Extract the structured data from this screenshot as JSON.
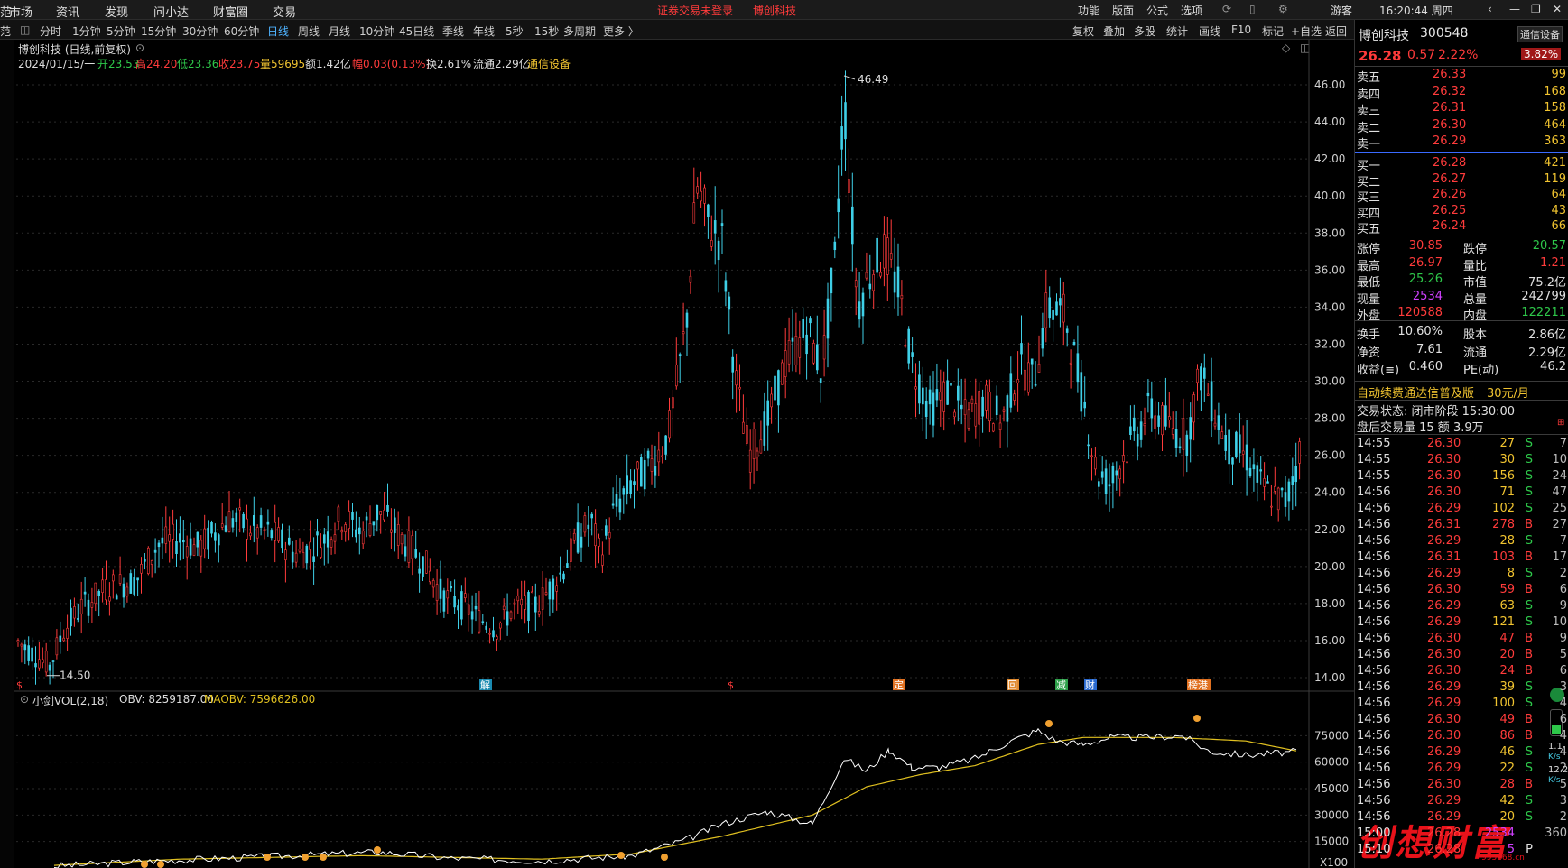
{
  "menu": {
    "left": [
      "范",
      "市场",
      "资讯",
      "发现",
      "问小达",
      "财富圈",
      "交易"
    ],
    "notice": "证券交易未登录",
    "stock_link": "博创科技",
    "right": [
      "功能",
      "版面",
      "公式",
      "选项"
    ],
    "guest": "游客",
    "clock": "16:20:44 周四"
  },
  "periods": [
    "分时",
    "1分钟",
    "5分钟",
    "15分钟",
    "30分钟",
    "60分钟",
    "日线",
    "周线",
    "月线",
    "10分钟",
    "45日线",
    "季线",
    "年线",
    "5秒",
    "15秒",
    "多周期",
    "更多 〉"
  ],
  "active_period": "日线",
  "tools": [
    "复权",
    "叠加",
    "多股",
    "统计",
    "画线",
    "F10",
    "标记",
    "+自选",
    "返回"
  ],
  "chart_header": {
    "title": "博创科技 (日线,前复权)",
    "date": "2024/01/15/一",
    "open": "开23.53",
    "high": "高24.20",
    "low": "低23.36",
    "close": "收23.75",
    "vol": "量59695",
    "amount": "额1.42亿",
    "range": "幅0.03(0.13%)",
    "turnover": "换2.61%",
    "float": "流通2.29亿",
    "sector": "通信设备"
  },
  "price_axis": [
    "46.00",
    "44.00",
    "42.00",
    "40.00",
    "38.00",
    "36.00",
    "34.00",
    "32.00",
    "30.00",
    "28.00",
    "26.00",
    "24.00",
    "22.00",
    "20.00",
    "18.00",
    "16.00",
    "14.00"
  ],
  "max_label": "46.49",
  "min_label": "14.50",
  "event_markers": [
    "$",
    "解",
    "$",
    "定",
    "回",
    "减",
    "财",
    "榜港"
  ],
  "indicator": {
    "name": "小剑VOL(2,18)",
    "obv": "OBV: 8259187.00",
    "maobv": "MAOBV: 7596626.00",
    "axis": [
      "75000",
      "60000",
      "45000",
      "30000",
      "15000"
    ],
    "unit": "X100"
  },
  "stock": {
    "name": "博创科技",
    "code": "300548",
    "sector_btn": "通信设备",
    "price": "26.28",
    "change": "0.57",
    "pct": "2.22%",
    "amp_badge": "3.82%"
  },
  "asks": [
    {
      "label": "卖五",
      "price": "26.33",
      "vol": "99"
    },
    {
      "label": "卖四",
      "price": "26.32",
      "vol": "168"
    },
    {
      "label": "卖三",
      "price": "26.31",
      "vol": "158"
    },
    {
      "label": "卖二",
      "price": "26.30",
      "vol": "464"
    },
    {
      "label": "卖一",
      "price": "26.29",
      "vol": "363"
    }
  ],
  "bids": [
    {
      "label": "买一",
      "price": "26.28",
      "vol": "421"
    },
    {
      "label": "买二",
      "price": "26.27",
      "vol": "119"
    },
    {
      "label": "买三",
      "price": "26.26",
      "vol": "64"
    },
    {
      "label": "买四",
      "price": "26.25",
      "vol": "43"
    },
    {
      "label": "买五",
      "price": "26.24",
      "vol": "66"
    }
  ],
  "stats": [
    {
      "k1": "涨停",
      "v1": "30.85",
      "c1": "red",
      "k2": "跌停",
      "v2": "20.57",
      "c2": "green"
    },
    {
      "k1": "最高",
      "v1": "26.97",
      "c1": "red",
      "k2": "量比",
      "v2": "1.21",
      "c2": "red"
    },
    {
      "k1": "最低",
      "v1": "25.26",
      "c1": "green",
      "k2": "市值",
      "v2": "75.2亿",
      "c2": "white"
    },
    {
      "k1": "现量",
      "v1": "2534",
      "c1": "purple",
      "k2": "总量",
      "v2": "242799",
      "c2": "white"
    },
    {
      "k1": "外盘",
      "v1": "120588",
      "c1": "red",
      "k2": "内盘",
      "v2": "122211",
      "c2": "green"
    }
  ],
  "stats2": [
    {
      "k1": "换手",
      "v1": "10.60%",
      "k2": "股本",
      "v2": "2.86亿"
    },
    {
      "k1": "净资",
      "v1": "7.61",
      "k2": "流通",
      "v2": "2.29亿"
    },
    {
      "k1": "收益(≡)",
      "v1": "0.460",
      "k2": "PE(动)",
      "v2": "46.2"
    }
  ],
  "promo": {
    "text": "自动续费通达信普及版",
    "price": "30元/月"
  },
  "trade_state": "交易状态: 闭市阶段 15:30:00",
  "after_hours": "盘后交易量 15 额 3.9万",
  "ticks": [
    {
      "t": "14:55",
      "p": "26.30",
      "v": "27",
      "s": "S",
      "n": "7"
    },
    {
      "t": "14:55",
      "p": "26.30",
      "v": "30",
      "s": "S",
      "n": "10"
    },
    {
      "t": "14:55",
      "p": "26.30",
      "v": "156",
      "s": "S",
      "n": "24"
    },
    {
      "t": "14:56",
      "p": "26.30",
      "v": "71",
      "s": "S",
      "n": "47"
    },
    {
      "t": "14:56",
      "p": "26.29",
      "v": "102",
      "s": "S",
      "n": "25"
    },
    {
      "t": "14:56",
      "p": "26.31",
      "v": "278",
      "s": "B",
      "n": "27"
    },
    {
      "t": "14:56",
      "p": "26.29",
      "v": "28",
      "s": "S",
      "n": "7"
    },
    {
      "t": "14:56",
      "p": "26.31",
      "v": "103",
      "s": "B",
      "n": "17"
    },
    {
      "t": "14:56",
      "p": "26.29",
      "v": "8",
      "s": "S",
      "n": "2"
    },
    {
      "t": "14:56",
      "p": "26.30",
      "v": "59",
      "s": "B",
      "n": "6"
    },
    {
      "t": "14:56",
      "p": "26.29",
      "v": "63",
      "s": "S",
      "n": "9"
    },
    {
      "t": "14:56",
      "p": "26.29",
      "v": "121",
      "s": "S",
      "n": "10"
    },
    {
      "t": "14:56",
      "p": "26.30",
      "v": "47",
      "s": "B",
      "n": "9"
    },
    {
      "t": "14:56",
      "p": "26.30",
      "v": "20",
      "s": "B",
      "n": "5"
    },
    {
      "t": "14:56",
      "p": "26.30",
      "v": "24",
      "s": "B",
      "n": "6"
    },
    {
      "t": "14:56",
      "p": "26.29",
      "v": "39",
      "s": "S",
      "n": "3"
    },
    {
      "t": "14:56",
      "p": "26.29",
      "v": "100",
      "s": "S",
      "n": "4"
    },
    {
      "t": "14:56",
      "p": "26.30",
      "v": "49",
      "s": "B",
      "n": "6"
    },
    {
      "t": "14:56",
      "p": "26.30",
      "v": "86",
      "s": "B",
      "n": "4"
    },
    {
      "t": "14:56",
      "p": "26.29",
      "v": "46",
      "s": "S",
      "n": "4"
    },
    {
      "t": "14:56",
      "p": "26.29",
      "v": "22",
      "s": "S",
      "n": "2"
    },
    {
      "t": "14:56",
      "p": "26.30",
      "v": "28",
      "s": "B",
      "n": "5"
    },
    {
      "t": "14:56",
      "p": "26.29",
      "v": "42",
      "s": "S",
      "n": "3"
    },
    {
      "t": "14:56",
      "p": "26.29",
      "v": "20",
      "s": "S",
      "n": "2"
    },
    {
      "t": "15:00",
      "p": "26.28",
      "v": "2534",
      "s": "",
      "n": "360"
    },
    {
      "t": "15:10",
      "p": "26.28",
      "v": "5",
      "s": "P",
      "n": ""
    }
  ],
  "speed": {
    "v1": "1.1",
    "u1": "K/s",
    "v2": "12.2",
    "u2": "K/s"
  },
  "watermark": "创想财富",
  "watermark_url": "995168.cn",
  "chart_data": {
    "type": "candlestick",
    "ylim": [
      13.4,
      46.8
    ],
    "max": 46.49,
    "min": 14.5,
    "obv_ylim": [
      0,
      90000
    ]
  },
  "colors": {
    "up": "#ff3b3b",
    "down": "#3fd0e8",
    "maobv": "#e0c020",
    "obv": "#ffffff",
    "bg": "#000000"
  }
}
